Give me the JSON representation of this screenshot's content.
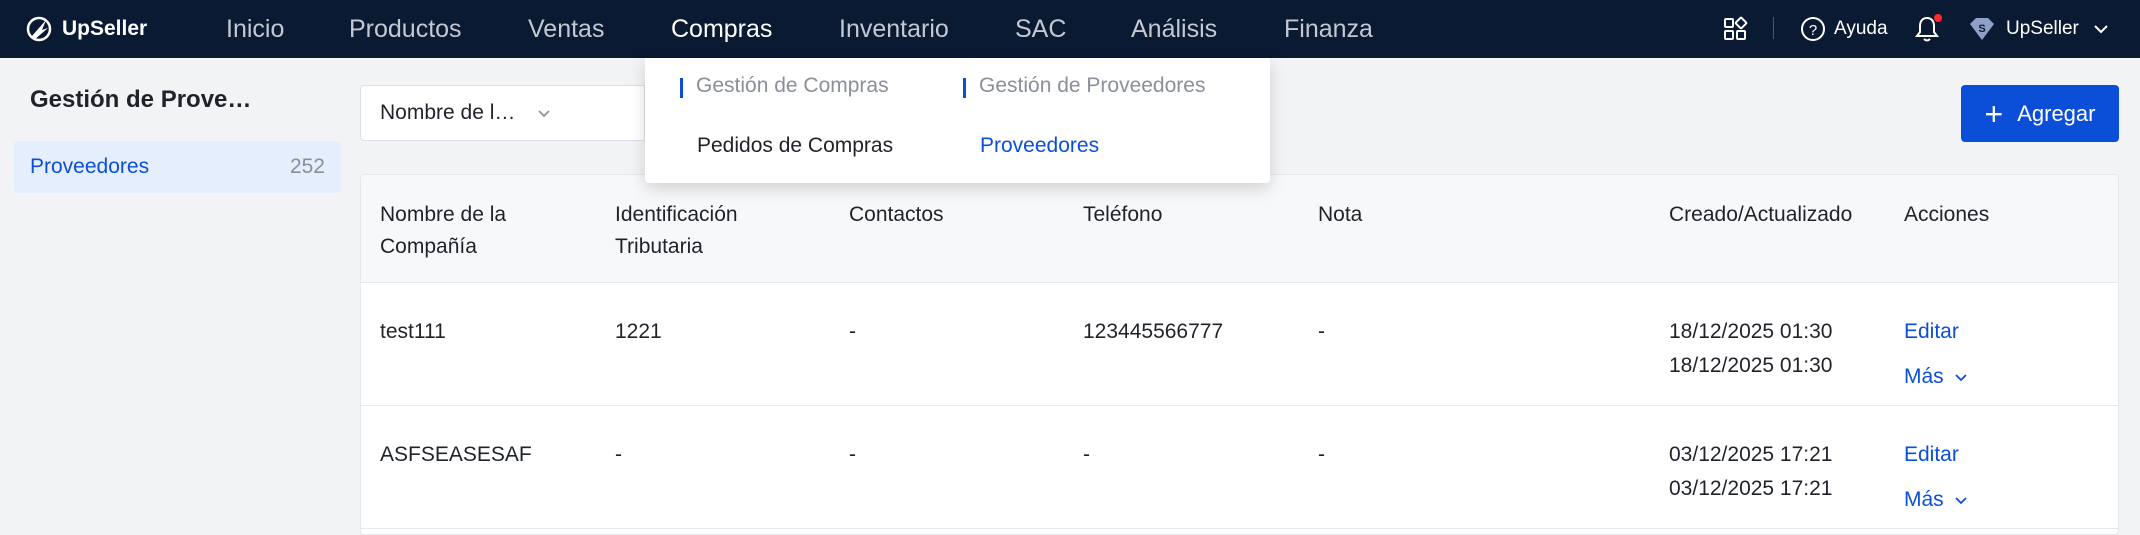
{
  "brand": "UpSeller",
  "nav": {
    "inicio": "Inicio",
    "productos": "Productos",
    "ventas": "Ventas",
    "compras": "Compras",
    "inventario": "Inventario",
    "sac": "SAC",
    "analisis": "Análisis",
    "finanza": "Finanza"
  },
  "topbar_right": {
    "help": "Ayuda",
    "account": "UpSeller"
  },
  "dropdown": {
    "group1": {
      "heading": "Gestión de Compras",
      "item": "Pedidos de Compras"
    },
    "group2": {
      "heading": "Gestión de Proveedores",
      "item": "Proveedores"
    }
  },
  "sidebar": {
    "title": "Gestión de Prove…",
    "items": [
      {
        "label": "Proveedores",
        "count": "252"
      }
    ]
  },
  "filter": {
    "select_value": "Nombre de l…"
  },
  "add_button": "Agregar",
  "table": {
    "headers": {
      "company_l1": "Nombre de la",
      "company_l2": "Compañía",
      "tax_l1": "Identificación",
      "tax_l2": "Tributaria",
      "contacts": "Contactos",
      "phone": "Teléfono",
      "note": "Nota",
      "created": "Creado/Actualizado",
      "actions": "Acciones"
    },
    "rows": [
      {
        "company": "test111",
        "tax_id": "1221",
        "contacts": "-",
        "phone": "123445566777",
        "note": "-",
        "created": "18/12/2025 01:30",
        "updated": "18/12/2025 01:30",
        "edit": "Editar",
        "more": "Más"
      },
      {
        "company": "ASFSEASESAF",
        "tax_id": "-",
        "contacts": "-",
        "phone": "-",
        "note": "-",
        "created": "03/12/2025 17:21",
        "updated": "03/12/2025 17:21",
        "edit": "Editar",
        "more": "Más"
      }
    ]
  },
  "colors": {
    "topbar": "#0b1a33",
    "accent": "#0b4fd9",
    "notification": "#ff2b2b"
  }
}
